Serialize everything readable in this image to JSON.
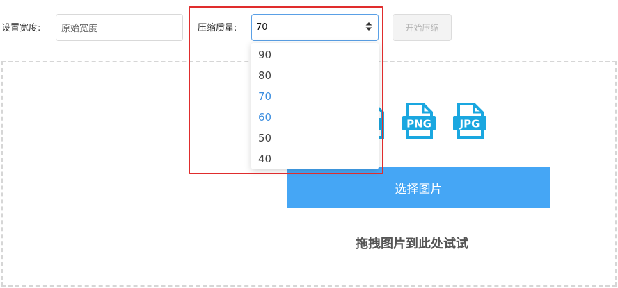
{
  "toolbar": {
    "width_label": "设置宽度:",
    "width_placeholder": "原始宽度",
    "quality_label": "压缩质量:",
    "quality_value": "70",
    "start_button": "开始压缩"
  },
  "quality_dropdown": {
    "options": [
      "90",
      "80",
      "70",
      "60",
      "50",
      "40"
    ],
    "selected": "70",
    "hovered": "60"
  },
  "upload": {
    "format_icons": [
      "PNG",
      "JPG"
    ],
    "choose_button": "选择图片",
    "drag_hint": "拖拽图片到此处试试"
  },
  "colors": {
    "accent": "#45a6f5",
    "icon": "#1aa7e0",
    "highlight_box": "#e02d2d",
    "selected_option": "#3c8ee0"
  },
  "icons": {
    "select_arrows": "up-down-caret-icon",
    "png": "png-file-icon",
    "jpg": "jpg-file-icon"
  }
}
